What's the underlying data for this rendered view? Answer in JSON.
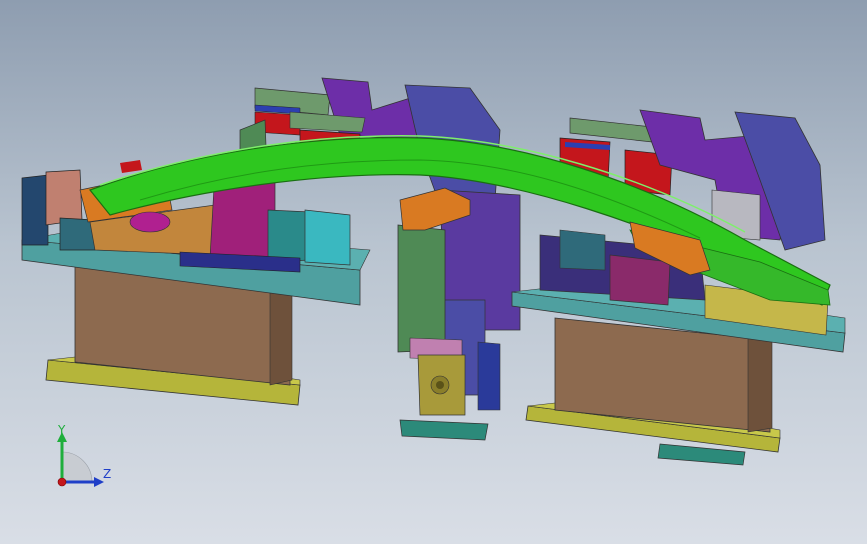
{
  "viewport": {
    "background_top": "#8e9db0",
    "background_bottom": "#d9dee6"
  },
  "model": {
    "description_icon": "cad-fixture-assembly",
    "colors": {
      "green_panel": "#2ec71f",
      "purple_block": "#6d2ea8",
      "blue_block": "#3d3f9e",
      "tan_base": "#8d6a4f",
      "yellow_plate": "#b5b53a",
      "teal_plate": "#4fa0a0",
      "red_block": "#c4161c",
      "orange_bracket": "#d97a22",
      "magenta_block": "#a0207a",
      "sage_plate": "#6e9a6c"
    }
  },
  "triad": {
    "y_label": "Y",
    "z_label": "Z",
    "y_color": "#1fae3c",
    "z_color": "#1f3fc8",
    "x_color": "#c4161c"
  }
}
